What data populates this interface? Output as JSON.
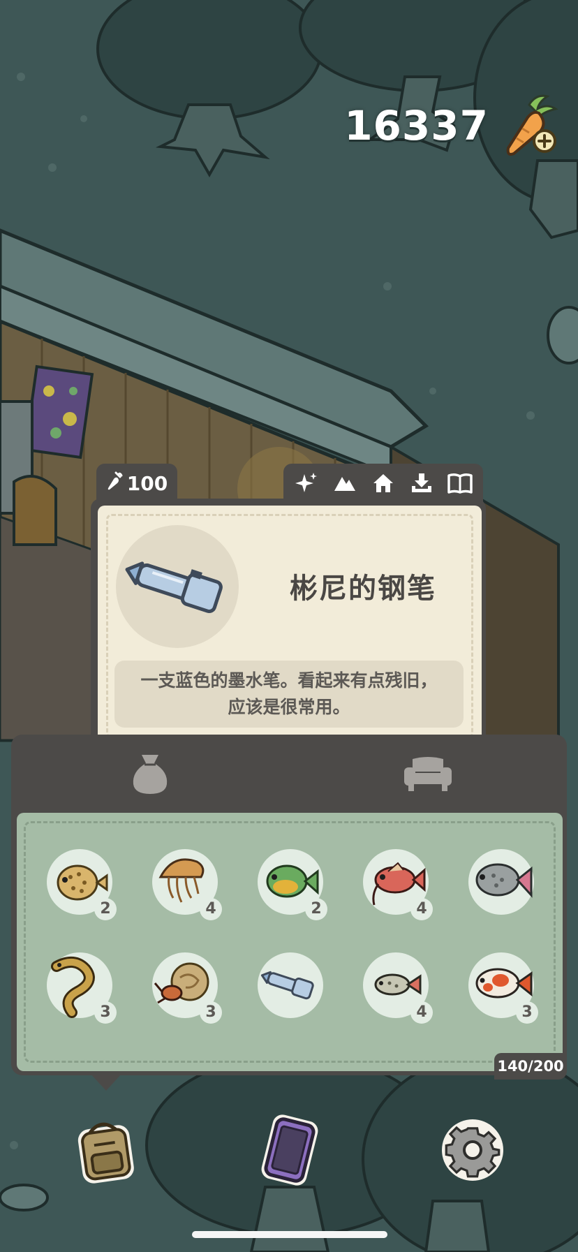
{
  "currency": {
    "amount": "16337",
    "icon": "carrot-plus-icon"
  },
  "item_card": {
    "price": "100",
    "price_icon": "carrot-icon",
    "name": "彬尼的钢笔",
    "description": "一支蓝色的墨水笔。看起来有点残旧，应该是很常用。",
    "item_icon": "blue-pen-icon",
    "filter_tabs": [
      {
        "icon": "sparkle-icon"
      },
      {
        "icon": "mountain-icon"
      },
      {
        "icon": "house-icon"
      },
      {
        "icon": "download-tray-icon"
      },
      {
        "icon": "book-icon"
      }
    ]
  },
  "inventory": {
    "tabs": [
      {
        "icon": "bag-icon",
        "selected": true
      },
      {
        "icon": "armchair-icon",
        "selected": false
      }
    ],
    "capacity": "140/200",
    "slots": [
      {
        "icon": "pufferfish-icon",
        "count": "2"
      },
      {
        "icon": "jellyfish-icon",
        "count": "4"
      },
      {
        "icon": "green-fish-icon",
        "count": "2"
      },
      {
        "icon": "red-catfish-icon",
        "count": "4"
      },
      {
        "icon": "grey-fish-icon",
        "count": ""
      },
      {
        "icon": "eel-icon",
        "count": "3"
      },
      {
        "icon": "hermit-crab-icon",
        "count": "3"
      },
      {
        "icon": "blue-pen-icon",
        "count": ""
      },
      {
        "icon": "small-fish-icon",
        "count": "4"
      },
      {
        "icon": "koi-icon",
        "count": "3"
      }
    ]
  },
  "bottom_nav": [
    {
      "icon": "backpack-icon"
    },
    {
      "icon": "phone-icon"
    },
    {
      "icon": "gear-icon"
    }
  ],
  "colors": {
    "panel": "#4c4a48",
    "card": "#f2ecd9",
    "grid": "#a5bca6",
    "scene": "#3e5756"
  }
}
